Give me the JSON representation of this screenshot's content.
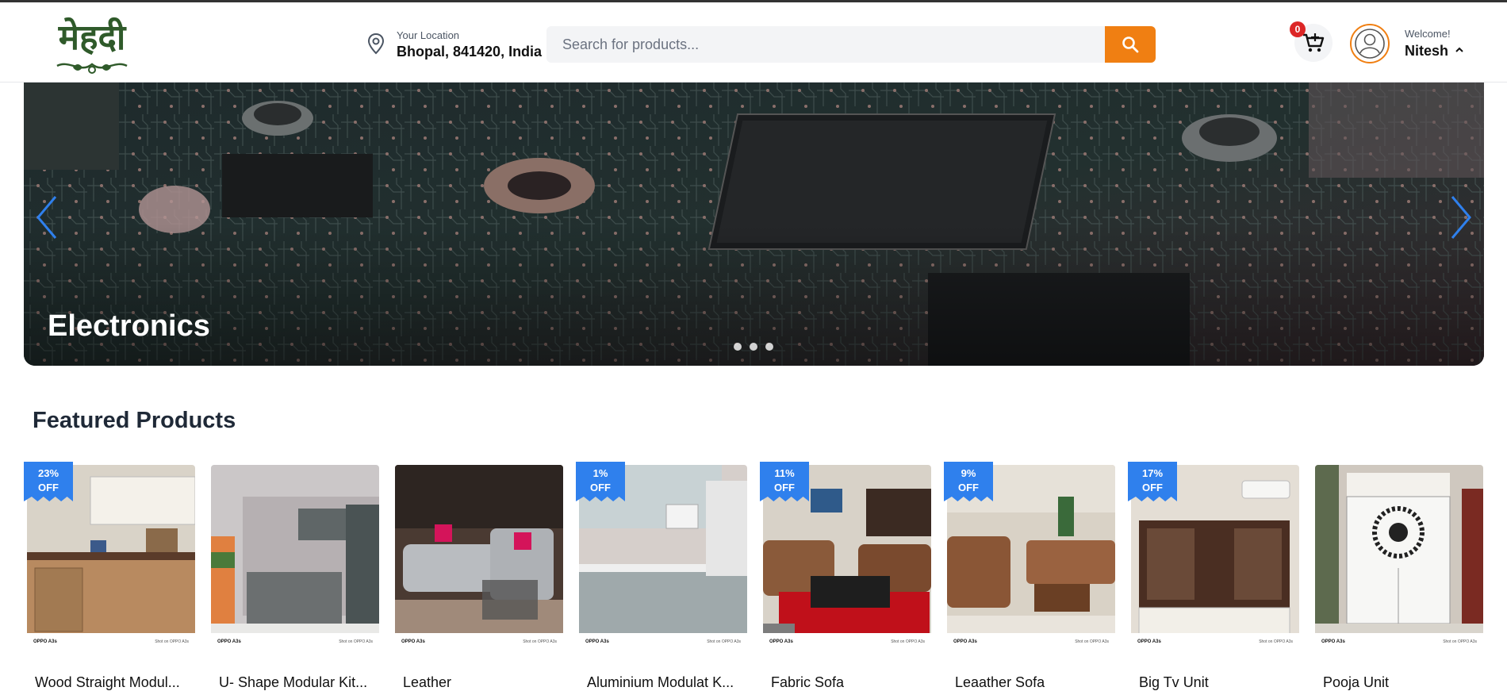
{
  "header": {
    "logo_text": "मेहदी",
    "location_label": "Your Location",
    "location_value": "Bhopal, 841420, India",
    "search_placeholder": "Search for products...",
    "cart_count": "0",
    "welcome_label": "Welcome!",
    "username": "Nitesh",
    "accent_color": "#f07f12"
  },
  "banner": {
    "title": "Electronics",
    "slides": 3,
    "active_slide": 1
  },
  "featured": {
    "title": "Featured Products",
    "products": [
      {
        "name": "Wood Straight Modul...",
        "discount": "23%",
        "off": "OFF",
        "theme": "kitchen-wood"
      },
      {
        "name": "U- Shape Modular Kit...",
        "discount": "",
        "off": "",
        "theme": "kitchen-grey"
      },
      {
        "name": "Leather",
        "discount": "",
        "off": "",
        "theme": "sofa-grey"
      },
      {
        "name": "Aluminium Modulat K...",
        "discount": "1%",
        "off": "OFF",
        "theme": "kitchen-light"
      },
      {
        "name": "Fabric Sofa",
        "discount": "11%",
        "off": "OFF",
        "theme": "sofa-brown"
      },
      {
        "name": "Leaather Sofa",
        "discount": "9%",
        "off": "OFF",
        "theme": "sofa-tan"
      },
      {
        "name": "Big Tv Unit",
        "discount": "17%",
        "off": "OFF",
        "theme": "tv-unit"
      },
      {
        "name": "Pooja Unit",
        "discount": "",
        "off": "",
        "theme": "pooja"
      }
    ],
    "caption_left": "OPPO A3s",
    "caption_right": "Shot on OPPO A3s"
  }
}
